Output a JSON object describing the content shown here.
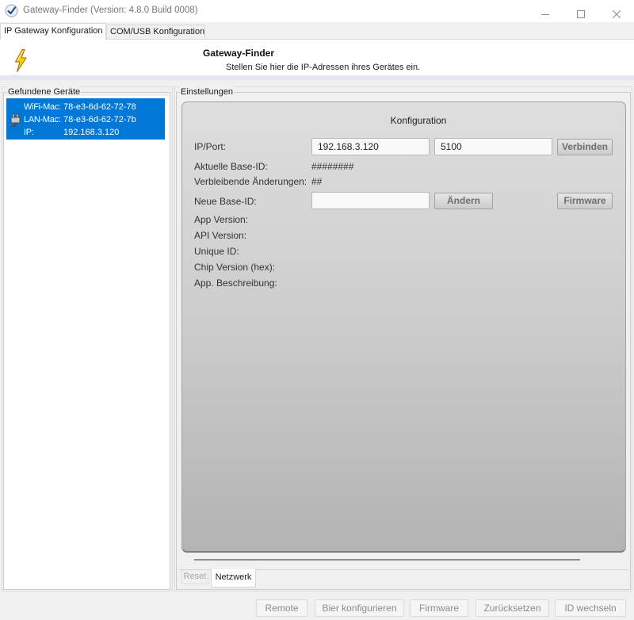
{
  "window": {
    "title": "Gateway-Finder (Version: 4.8.0 Build 0008)",
    "icons": {
      "app": "app-check-icon",
      "minimize": "minimize-icon",
      "maximize": "maximize-icon",
      "close": "close-icon"
    }
  },
  "tabs": [
    {
      "label": "IP Gateway Konfiguration",
      "selected": true
    },
    {
      "label": "COM/USB Konfiguration",
      "selected": false
    }
  ],
  "header": {
    "icon": "lightning-icon",
    "title": "Gateway-Finder",
    "subtitle": "Stellen Sie hier die IP-Adressen ihres Gerätes ein."
  },
  "devices": {
    "title": "Gefundene Geräte",
    "items": [
      {
        "icon": "network-plug-icon",
        "selected": true,
        "wifi_mac_label": "WiFi-Mac:",
        "wifi_mac": "78-e3-6d-62-72-78",
        "lan_mac_label": "LAN-Mac:",
        "lan_mac": "78-e3-6d-62-72-7b",
        "ip_label": "IP:",
        "ip": "192.168.3.120"
      }
    ]
  },
  "settings": {
    "title": "Einstellungen",
    "panel_title": "Konfiguration",
    "ip_port": {
      "label": "IP/Port:",
      "ip": "192.168.3.120",
      "port": "5100",
      "button": "Verbinden"
    },
    "base_id": {
      "label": "Aktuelle Base-ID:",
      "value": "########"
    },
    "remaining_changes": {
      "label": "Verbleibende Änderungen:",
      "value": "##"
    },
    "new_base_id": {
      "label": "Neue Base-ID:",
      "value": "",
      "button": "Ändern",
      "firmware_button": "Firmware"
    },
    "info": {
      "app_version": "App Version:",
      "api_version": "API Version:",
      "unique_id": "Unique ID:",
      "chip_version": "Chip Version (hex):",
      "app_description": "App. Beschreibung:"
    },
    "subtabs": [
      {
        "label": "Reset",
        "selected": false,
        "enabled": false
      },
      {
        "label": "Netzwerk",
        "selected": true,
        "enabled": true
      }
    ]
  },
  "footer": {
    "buttons": [
      {
        "label": "Remote",
        "enabled": false
      },
      {
        "label": "Bier konfigurieren",
        "enabled": false
      },
      {
        "label": "Firmware",
        "enabled": false
      },
      {
        "label": "Zurücksetzen",
        "enabled": false
      },
      {
        "label": "ID wechseln",
        "enabled": false
      }
    ]
  },
  "colors": {
    "selection": "#0078d7",
    "window_bg": "#f0f0f0",
    "header_band": "#e3e8f0",
    "lightning": "#ffd200"
  }
}
